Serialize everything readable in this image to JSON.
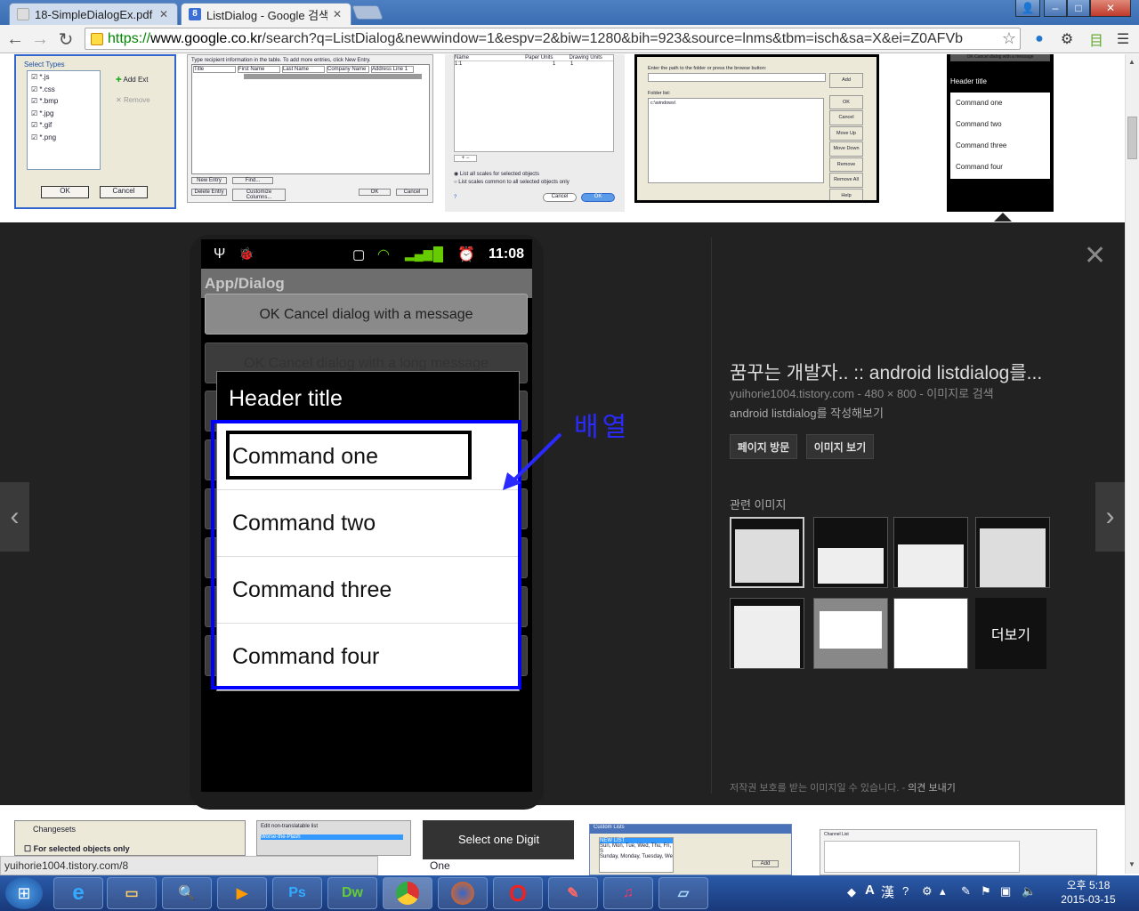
{
  "tabs": [
    {
      "title": "18-SimpleDialogEx.pdf",
      "active": false
    },
    {
      "title": "ListDialog - Google 검색",
      "active": true
    }
  ],
  "window_controls": {
    "minimize": "–",
    "maximize": "□",
    "close": "✕"
  },
  "url": {
    "scheme": "https://",
    "domain": "www.google.co.kr",
    "path": "/search?q=ListDialog&newwindow=1&espv=2&biw=1280&bih=923&source=lnms&tbm=isch&sa=X&ei=Z0AFVb"
  },
  "thumb1": {
    "title": "Select Types",
    "items": [
      "*.js",
      "*.css",
      "*.bmp",
      "*.jpg",
      "*.gif",
      "*.png"
    ],
    "add_ext": "Add Ext",
    "remove": "Remove",
    "ok": "OK",
    "cancel": "Cancel"
  },
  "thumb2": {
    "hint": "Type recipient information in the table. To add more entries, click New Entry.",
    "cols": [
      "Title",
      "First Name",
      "Last Name",
      "Company Name",
      "Address Line 1"
    ],
    "btns": [
      "New Entry",
      "Find...",
      "Delete Entry",
      "Customize Columns...",
      "OK",
      "Cancel"
    ]
  },
  "thumb3": {
    "cols": [
      "Name",
      "Paper Units",
      "Drawing Units"
    ],
    "row": [
      "1:1",
      "1",
      "1"
    ],
    "opt1": "List all scales for selected objects",
    "opt2": "List scales common to all selected objects only",
    "cancel": "Cancel",
    "ok": "OK"
  },
  "thumb4": {
    "hint": "Enter the path to the folder or press the browse button:",
    "folder_label": "Folder list:",
    "folder_value": "c:\\windows\\",
    "btns": [
      "Add",
      "OK",
      "Cancel",
      "Move Up",
      "Move Down",
      "Remove",
      "Remove All",
      "Help"
    ]
  },
  "thumb5": {
    "top": "OK Cancel dialog with a message",
    "header": "Header title",
    "items": [
      "Command one",
      "Command two",
      "Command three",
      "Command four"
    ]
  },
  "phone": {
    "time": "11:08",
    "app_title": "App/Dialog",
    "bg_buttons": [
      "OK Cancel dialog with a message",
      "OK Cancel dialog with a long message"
    ],
    "dialog_title": "Header title",
    "items": [
      "Command one",
      "Command two",
      "Command three",
      "Command four"
    ]
  },
  "annotation": "배열",
  "detail": {
    "title": "꿈꾸는 개발자.. :: android listdialog를...",
    "source": "yuihorie1004.tistory.com",
    "size": "480 × 800",
    "search_by_image": "이미지로 검색",
    "description": "android listdialog를 작성해보기",
    "visit": "페이지 방문",
    "view_image": "이미지 보기",
    "related": "관련 이미지",
    "more": "더보기",
    "copyright": "저작권 보호를 받는 이미지일 수 있습니다.",
    "feedback": "의견 보내기"
  },
  "bottom_thumbs": {
    "changesets": "Changesets",
    "for_selected": "For selected objects only",
    "edit_list": "Edit non-translatable list",
    "worse": "Worse-the-Plash",
    "select_digit": "Select one Digit",
    "one": "One",
    "custom_lists": "Custom Lists",
    "new_list": "NEW LIST",
    "days": "Sun, Mon, Tue, Wed, Thu, Fri, S",
    "sunday": "Sunday, Monday, Tuesday, We",
    "add": "Add",
    "channel_list": "Channel List"
  },
  "status_url": "yuihorie1004.tistory.com/8",
  "taskbar": {
    "apps": [
      "Ps",
      "Dw"
    ]
  },
  "tray": {
    "ime": "A",
    "hanja": "漢",
    "time": "오후 5:18",
    "date": "2015-03-15"
  }
}
